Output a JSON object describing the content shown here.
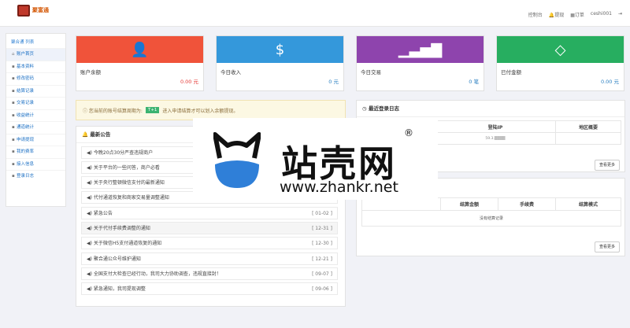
{
  "brand": {
    "logo_text": "聚富通"
  },
  "topnav": {
    "console": "控制台",
    "notice": "提现",
    "orders": "订单",
    "user": "ceshi001",
    "logout": ""
  },
  "sidebar": {
    "title": "聚合通 列表",
    "items": [
      {
        "label": "账户首页",
        "icon": "home-icon"
      },
      {
        "label": "基本资料",
        "icon": "user-icon"
      },
      {
        "label": "修改密码",
        "icon": "key-icon"
      },
      {
        "label": "结算记录",
        "icon": "list-icon"
      },
      {
        "label": "交易记录",
        "icon": "list-icon"
      },
      {
        "label": "收益统计",
        "icon": "chart-icon"
      },
      {
        "label": "通道统计",
        "icon": "chart-icon"
      },
      {
        "label": "申请提现",
        "icon": "money-icon"
      },
      {
        "label": "我的费率",
        "icon": "rate-icon"
      },
      {
        "label": "接入信息",
        "icon": "link-icon"
      },
      {
        "label": "登录日志",
        "icon": "log-icon"
      }
    ]
  },
  "cards": [
    {
      "label": "账户余额",
      "value": "0.00 元",
      "color": "#f0533a",
      "value_color": "#e53935",
      "icon": "user-icon",
      "glyph": "👤"
    },
    {
      "label": "今日收入",
      "value": "0 元",
      "color": "#3498db",
      "value_color": "#2a7fc1",
      "icon": "dollar-icon",
      "glyph": "$"
    },
    {
      "label": "今日交易",
      "value": "0 笔",
      "color": "#8e44ad",
      "value_color": "#2a7fc1",
      "icon": "bar-chart-icon",
      "glyph": "▁▃▅▇"
    },
    {
      "label": "已付金额",
      "value": "0.00 元",
      "color": "#27ae60",
      "value_color": "#2a7fc1",
      "icon": "diamond-icon",
      "glyph": "◇"
    }
  ],
  "notice": {
    "prefix": "您当前的账号结算周期为:",
    "tag": "T+1",
    "suffix": "进入申请结算才可以划入余额提现。"
  },
  "announcements": {
    "title": "最新公告",
    "items": [
      {
        "text": "今晚20点30分严查违规商户",
        "date": ""
      },
      {
        "text": "关于平台的一些问答，商户必看",
        "date": ""
      },
      {
        "text": "关于央行整顿微信支付的最新通知",
        "date": ""
      },
      {
        "text": "代付通道恢复和商家交易量调整通知",
        "date": ""
      },
      {
        "text": "紧急公告",
        "date": "[ 01-02 ]"
      },
      {
        "text": "关于代付手续费调整的通知",
        "date": "[ 12-31 ]"
      },
      {
        "text": "关于微信H5支付通道恢复的通知",
        "date": "[ 12-30 ]"
      },
      {
        "text": "聚合通公众号维护通知",
        "date": "[ 12-21 ]"
      },
      {
        "text": "全国支付大检查已经行动，我司大力协助调查，违规直接封！",
        "date": "[ 09-07 ]"
      },
      {
        "text": "紧急通知，我司提现调整",
        "date": "[ 09-06 ]"
      }
    ]
  },
  "login_log": {
    "title": "最近登录日志",
    "headers": [
      "",
      "登陆IP",
      "地区概要"
    ],
    "row": [
      "",
      "59.3.▒▒▒▒",
      ""
    ],
    "more": "查看更多"
  },
  "settle": {
    "headers": [
      "",
      "结算金额",
      "手续费",
      "结算模式"
    ],
    "empty": "没有结算记录",
    "more": "查看更多"
  },
  "watermark": {
    "cn": "站壳网",
    "url": "www.zhankr.net",
    "reg": "®"
  }
}
